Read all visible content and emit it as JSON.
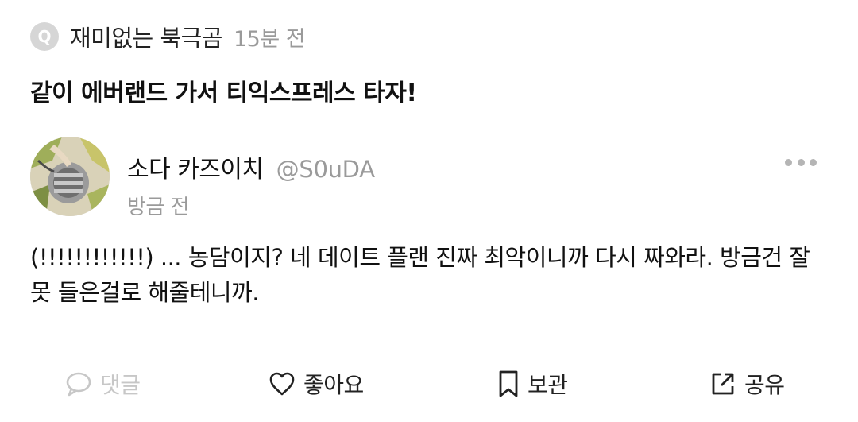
{
  "question": {
    "badge": "Q",
    "asker": "재미없는 북극곰",
    "time": "15분 전",
    "text": "같이 에버랜드 가서 티익스프레스 타자!"
  },
  "answer": {
    "author_name": "소다 카즈이치",
    "author_handle": "@S0uDA",
    "time": "방금 전",
    "text": "(!!!!!!!!!!!!) ... 농담이지? 네 데이트 플랜 진짜 최악이니까 다시 짜와라. 방금건 잘 못 들은걸로 해줄테니까."
  },
  "icons": {
    "more": "more-dots-icon",
    "comment": "comment-bubble-icon",
    "like": "heart-icon",
    "bookmark": "bookmark-icon",
    "share": "share-icon"
  },
  "actions": {
    "comment": "댓글",
    "like": "좋아요",
    "bookmark": "보관",
    "share": "공유"
  },
  "colors": {
    "muted_text": "#9a9a9a",
    "disabled": "#c7c7c7",
    "badge": "#d6d6d6"
  }
}
